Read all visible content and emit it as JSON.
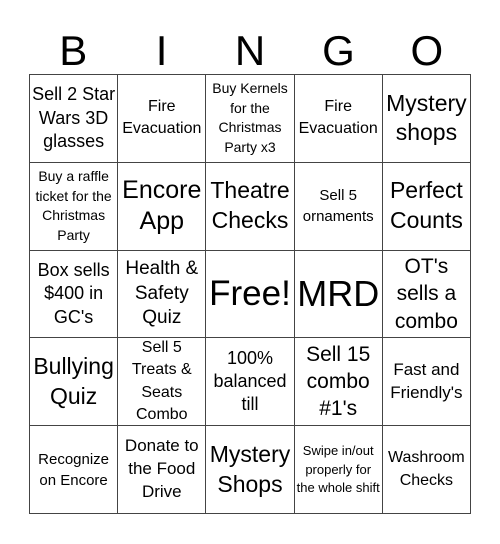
{
  "title_letters": [
    "B",
    "I",
    "N",
    "G",
    "O"
  ],
  "rows": [
    [
      "Sell 2 Star Wars 3D glasses",
      "Fire Evacuation",
      "Buy Kernels for the Christmas Party x3",
      "Fire Evacuation",
      "Mystery shops"
    ],
    [
      "Buy a raffle ticket for the Christmas Party",
      "Encore App",
      "Theatre Checks",
      "Sell 5 ornaments",
      "Perfect Counts"
    ],
    [
      "Box sells $400 in GC's",
      "Health & Safety Quiz",
      "Free!",
      "MRD",
      "OT's sells a combo"
    ],
    [
      "Bullying Quiz",
      "Sell 5 Treats & Seats Combo",
      "100% balanced till",
      "Sell 15 combo #1's",
      "Fast and Friendly's"
    ],
    [
      "Recognize on Encore",
      "Donate to the Food Drive",
      "Mystery Shops",
      "Swipe in/out properly for the whole shift",
      "Washroom Checks"
    ]
  ]
}
